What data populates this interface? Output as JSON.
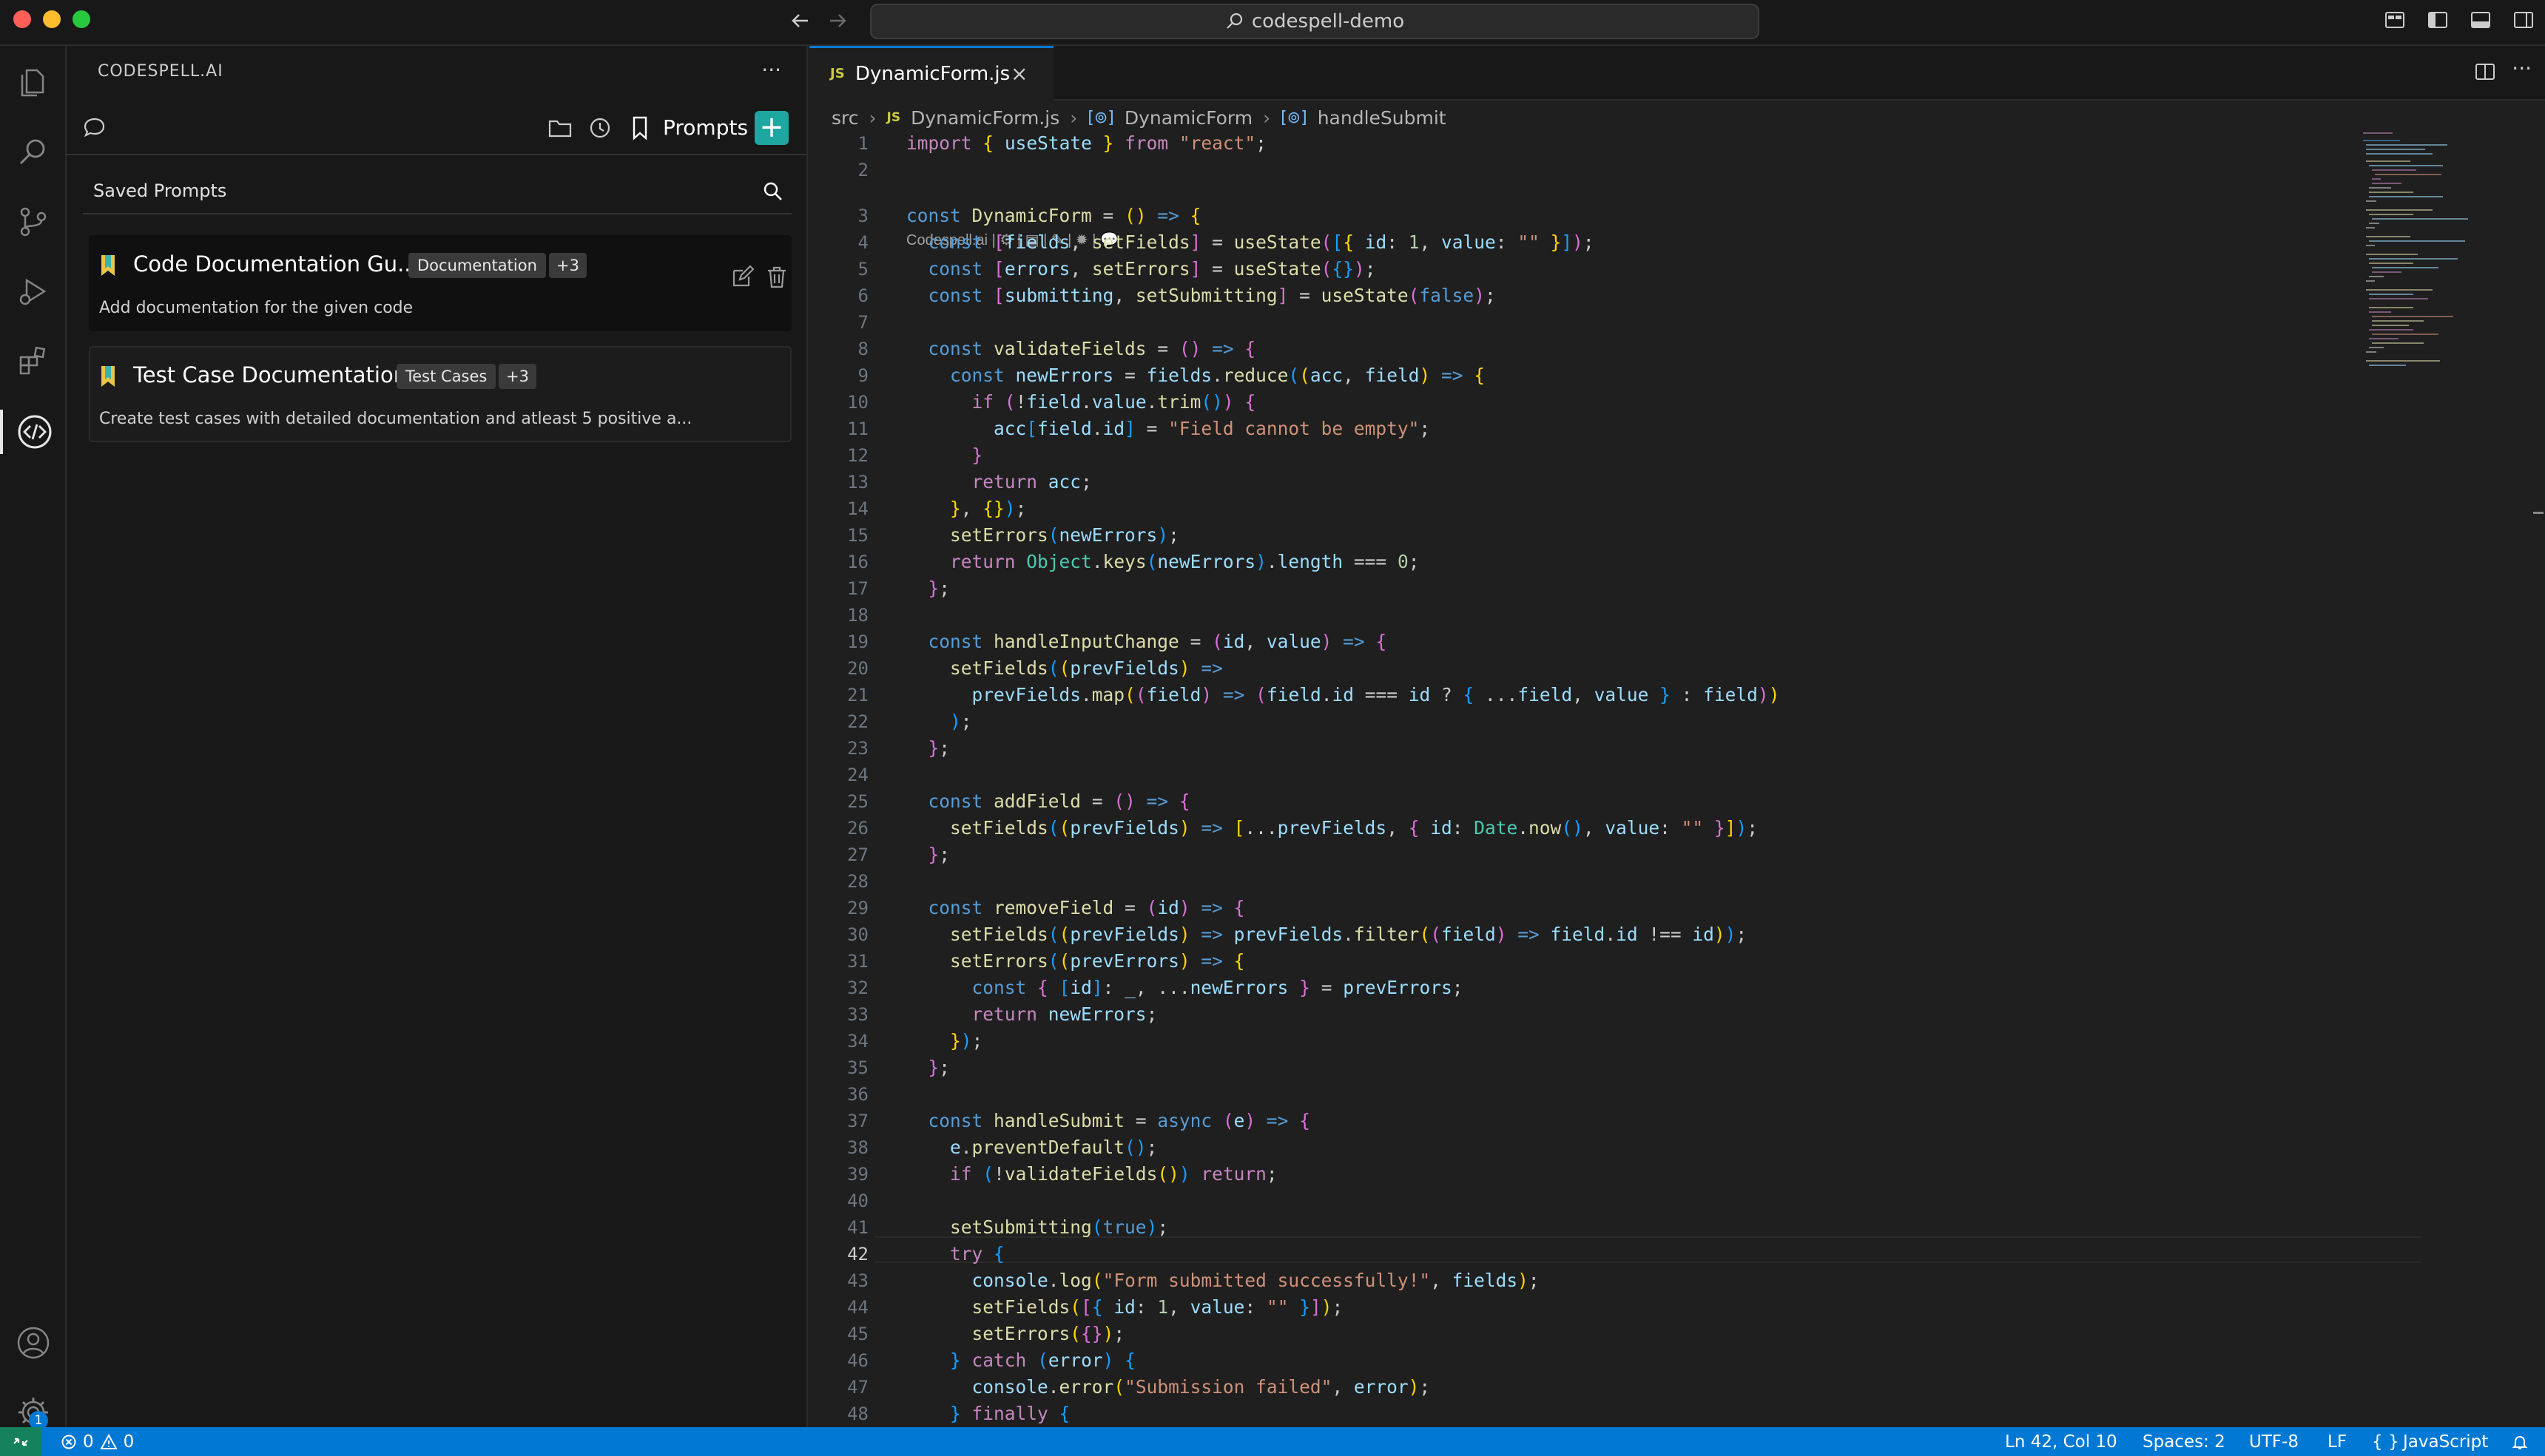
{
  "window": {
    "command_center": "codespell-demo"
  },
  "sidebar": {
    "title": "CODESPELL.AI",
    "toolbar": {
      "prompts_label": "Prompts",
      "add_label": "+"
    },
    "saved_prompts": {
      "title": "Saved Prompts",
      "cards": [
        {
          "title": "Code Documentation Gu...",
          "tag": "Documentation",
          "more": "+3",
          "description": "Add documentation for the given code"
        },
        {
          "title": "Test Case Documentation",
          "tag": "Test Cases",
          "more": "+3",
          "description": "Create test cases with detailed documentation and atleast 5 positive a..."
        }
      ]
    }
  },
  "editor": {
    "tab": {
      "icon_text": "JS",
      "filename": "DynamicForm.js",
      "close": "×"
    },
    "breadcrumb": {
      "folder": "src",
      "file_icon": "JS",
      "file": "DynamicForm.js",
      "symbol1": "DynamicForm",
      "symbol2": "handleSubmit"
    },
    "codelens": "Codespell.ai | ⚙ | ▤ | ✎ | ✹ | 💬",
    "current_line": 42,
    "line_numbers": [
      "1",
      "2",
      "3",
      "4",
      "5",
      "6",
      "7",
      "8",
      "9",
      "10",
      "11",
      "12",
      "13",
      "14",
      "15",
      "16",
      "17",
      "18",
      "19",
      "20",
      "21",
      "22",
      "23",
      "24",
      "25",
      "26",
      "27",
      "28",
      "29",
      "30",
      "31",
      "32",
      "33",
      "34",
      "35",
      "36",
      "37",
      "38",
      "39",
      "40",
      "41",
      "42",
      "43",
      "44",
      "45",
      "46",
      "47",
      "48"
    ]
  },
  "activity_bar": {
    "icons": [
      "explorer-icon",
      "search-icon",
      "source-control-icon",
      "run-debug-icon",
      "extensions-icon",
      "codespell-icon"
    ],
    "bottom_icons": [
      "account-icon",
      "settings-gear-icon"
    ],
    "settings_badge": "1"
  },
  "statusbar": {
    "errors": "0",
    "warnings": "0",
    "position": "Ln 42, Col 10",
    "spaces": "Spaces: 2",
    "encoding": "UTF-8",
    "eol": "LF",
    "language": "JavaScript",
    "language_icon": "{ }"
  },
  "colors": {
    "accent": "#0078d4",
    "add_button": "#1ea7a0",
    "statusbar": "#0078d4",
    "remote": "#16825d"
  }
}
